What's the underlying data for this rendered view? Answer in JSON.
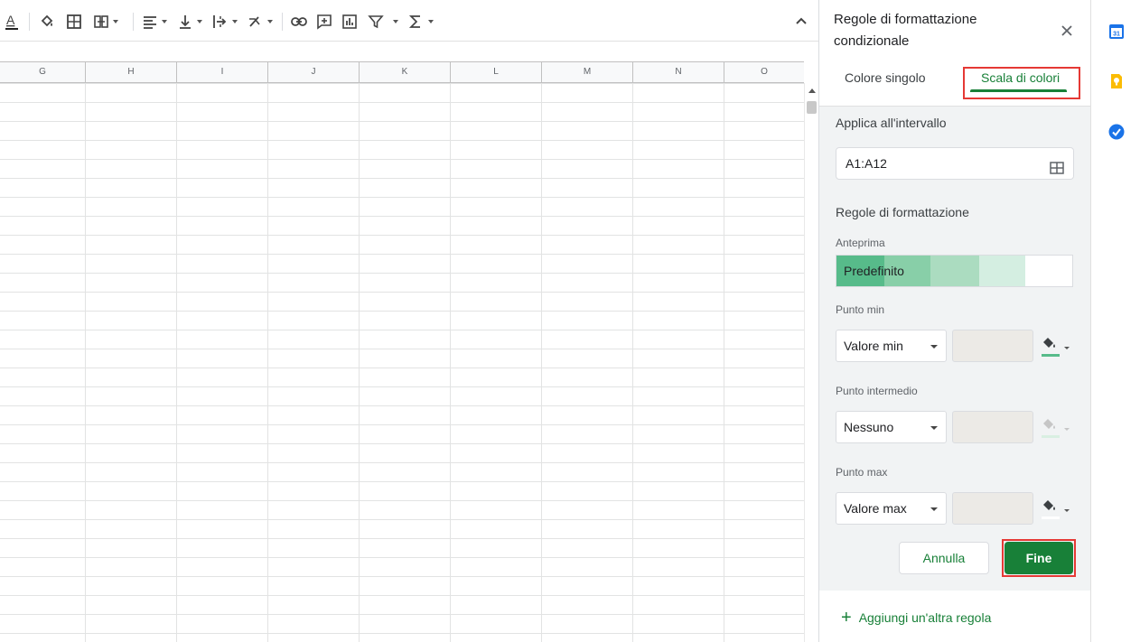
{
  "toolbar": {
    "icons": [
      "text-color-icon",
      "fill-color-icon",
      "borders-icon",
      "merge-cells-icon",
      "align-horizontal-icon",
      "align-vertical-icon",
      "text-wrap-icon",
      "text-rotation-icon",
      "insert-link-icon",
      "insert-comment-icon",
      "insert-chart-icon",
      "filter-icon",
      "functions-icon",
      "collapse-icon"
    ]
  },
  "grid": {
    "columns": [
      "G",
      "H",
      "I",
      "J",
      "K",
      "L",
      "M",
      "N",
      "O"
    ]
  },
  "panel": {
    "title": "Regole di formattazione condizionale",
    "tabs": [
      {
        "label": "Colore singolo",
        "active": false
      },
      {
        "label": "Scala di colori",
        "active": true
      }
    ],
    "range_label": "Applica all'intervallo",
    "range_value": "A1:A12",
    "rules_label": "Regole di formattazione",
    "preview_label": "Anteprima",
    "preview_value": "Predefinito",
    "preview_colors": [
      "#57bb8a",
      "#88cfa8",
      "#abdcc0",
      "#d4eee1",
      "#ffffff"
    ],
    "min_label": "Punto min",
    "min_select": "Valore min",
    "min_color": "#57bb8a",
    "mid_label": "Punto intermedio",
    "mid_select": "Nessuno",
    "mid_color": "#d9efe2",
    "max_label": "Punto max",
    "max_select": "Valore max",
    "max_color": "#ffffff",
    "cancel_label": "Annulla",
    "done_label": "Fine",
    "add_rule_label": "Aggiungi un'altra regola"
  },
  "colors": {
    "accent": "#188038",
    "highlight": "#e53935"
  },
  "rail": {
    "icons": [
      "calendar-icon",
      "keep-icon",
      "tasks-icon"
    ],
    "calendar_day": "31"
  }
}
